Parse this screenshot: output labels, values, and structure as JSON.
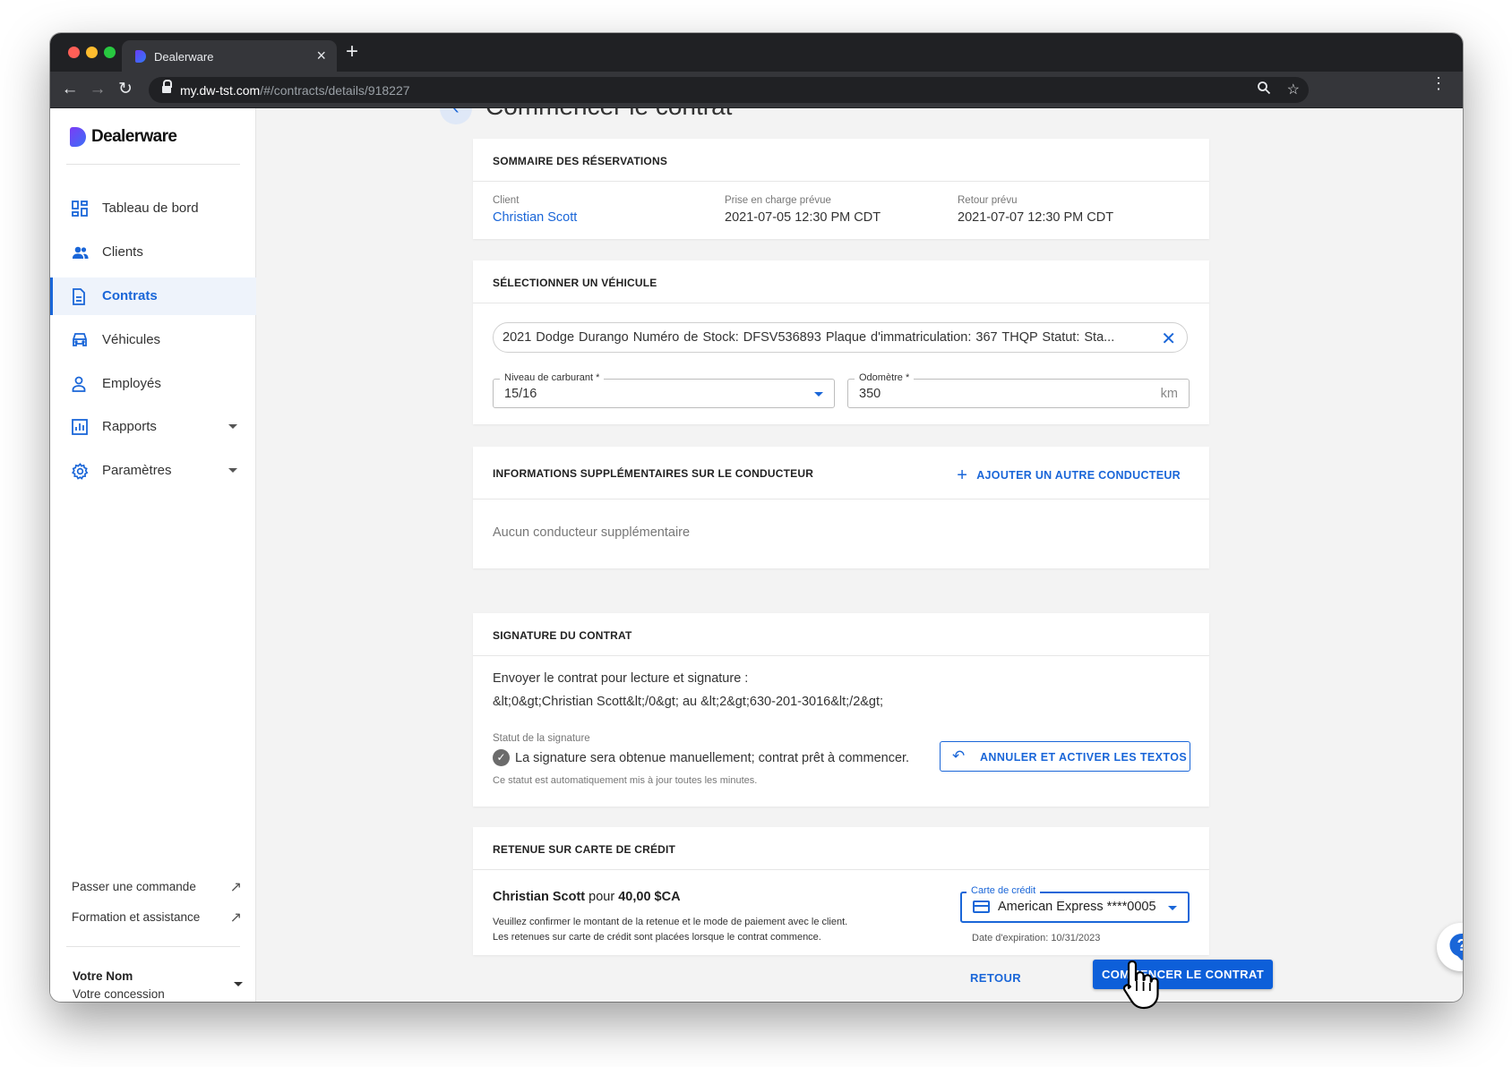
{
  "browser": {
    "tab_title": "Dealerware",
    "url_host": "my.dw-tst.com",
    "url_path": "/#/contracts/details/918227"
  },
  "sidebar": {
    "brand": "Dealerware",
    "items": [
      {
        "label": "Tableau de bord",
        "icon": "dashboard-icon"
      },
      {
        "label": "Clients",
        "icon": "people-icon"
      },
      {
        "label": "Contrats",
        "icon": "document-icon",
        "active": true
      },
      {
        "label": "Véhicules",
        "icon": "car-icon"
      },
      {
        "label": "Employés",
        "icon": "person-icon"
      },
      {
        "label": "Rapports",
        "icon": "chart-icon",
        "expandable": true
      },
      {
        "label": "Paramètres",
        "icon": "gear-icon",
        "expandable": true
      }
    ],
    "links": [
      {
        "label": "Passer une commande"
      },
      {
        "label": "Formation et assistance"
      }
    ],
    "user": {
      "name": "Votre Nom",
      "dealer": "Votre concession"
    }
  },
  "page": {
    "title": "Commencer le contrat"
  },
  "reservation_summary": {
    "title": "SOMMAIRE DES RÉSERVATIONS",
    "client_label": "Client",
    "client_value": "Christian Scott",
    "pickup_label": "Prise en charge prévue",
    "pickup_value": "2021-07-05 12:30 PM CDT",
    "return_label": "Retour prévu",
    "return_value": "2021-07-07 12:30 PM CDT"
  },
  "vehicle": {
    "title": "SÉLECTIONNER UN VÉHICULE",
    "selected": "2021 Dodge Durango   Numéro de Stock: DFSV536893   Plaque d'immatriculation: 367 THQP   Statut: Sta...",
    "fuel_label": "Niveau de carburant *",
    "fuel_value": "15/16",
    "odometer_label": "Odomètre *",
    "odometer_value": "350",
    "odometer_unit": "km"
  },
  "drivers": {
    "title": "INFORMATIONS SUPPLÉMENTAIRES SUR LE CONDUCTEUR",
    "add_label": "AJOUTER UN AUTRE CONDUCTEUR",
    "empty_text": "Aucun conducteur supplémentaire"
  },
  "signature": {
    "title": "SIGNATURE DU CONTRAT",
    "send_line1": "Envoyer le contrat pour lecture et signature :",
    "send_line2": "&lt;0&gt;Christian Scott&lt;/0&gt; au &lt;2&gt;630-201-3016&lt;/2&gt;",
    "status_label": "Statut de la signature",
    "status_text": "La signature sera obtenue manuellement; contrat prêt à commencer.",
    "status_note": "Ce statut est automatiquement mis à jour toutes les minutes.",
    "button_label": "ANNULER ET ACTIVER LES TEXTOS"
  },
  "credit_hold": {
    "title": "RETENUE SUR CARTE DE CRÉDIT",
    "client_name": "Christian Scott",
    "for_word": "pour",
    "amount": "40,00 $CA",
    "note_line1": "Veuillez confirmer le montant de la retenue et le mode de paiement avec le client.",
    "note_line2": "Les retenues sur carte de crédit sont placées lorsque le contrat commence.",
    "card_label": "Carte de crédit",
    "card_value": "American Express ****0005",
    "expiry": "Date d'expiration: 10/31/2023"
  },
  "footer": {
    "back_label": "RETOUR",
    "start_label": "COMMENCER LE CONTRAT"
  },
  "colors": {
    "accent": "#1a66d8",
    "primary_button": "#0d5fd9"
  }
}
